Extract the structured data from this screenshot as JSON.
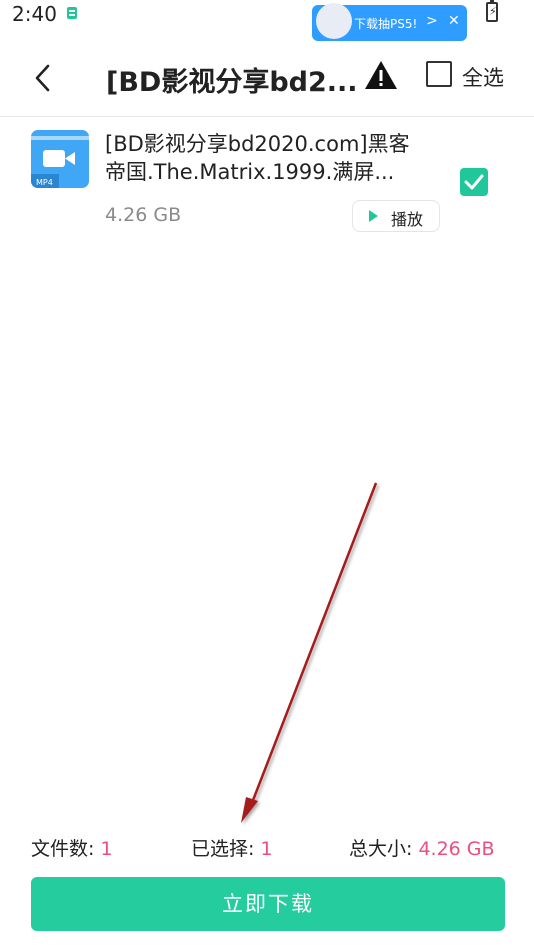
{
  "status_bar": {
    "time": "2:40"
  },
  "promo": {
    "text": "下载抽PS5!"
  },
  "header": {
    "title": "[BD影视分享bd2...",
    "select_all": "全选"
  },
  "file": {
    "name": "[BD影视分享bd2020.com]黑客帝国.The.Matrix.1999.满屏...",
    "size": "4.26 GB",
    "thumb_label": "MP4",
    "play_label": "播放",
    "checked": true
  },
  "footer": {
    "file_count_label": "文件数:",
    "file_count": "1",
    "selected_label": "已选择:",
    "selected": "1",
    "total_size_label": "总大小:",
    "total_size": "4.26 GB",
    "download_label": "立即下载"
  },
  "colors": {
    "accent": "#25cc9e",
    "value_pink": "#ee4e7e",
    "thumb_blue": "#3fa7f5",
    "arrow": "#a51c1c"
  }
}
